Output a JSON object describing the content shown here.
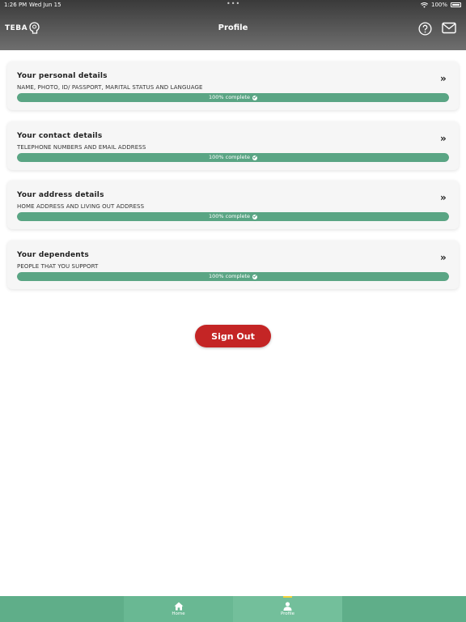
{
  "status_bar": {
    "time": "1:26 PM",
    "date": "Wed Jun 15",
    "battery": "100%"
  },
  "header": {
    "logo": "TEBA",
    "title": "Profile",
    "icons": [
      "help-icon",
      "mail-icon"
    ]
  },
  "cards": [
    {
      "title": "Your personal details",
      "subtitle": "NAME, PHOTO, ID/ PASSPORT, MARITAL STATUS AND LANGUAGE",
      "progress_label": "100% complete",
      "progress": 1.0
    },
    {
      "title": "Your contact details",
      "subtitle": "TELEPHONE NUMBERS AND EMAIL ADDRESS",
      "progress_label": "100% complete",
      "progress": 1.0
    },
    {
      "title": "Your address details",
      "subtitle": "HOME ADDRESS AND LIVING OUT ADDRESS",
      "progress_label": "100% complete",
      "progress": 1.0
    },
    {
      "title": "Your dependents",
      "subtitle": "PEOPLE THAT YOU SUPPORT",
      "progress_label": "100% complete",
      "progress": 1.0
    }
  ],
  "sign_out_label": "Sign Out",
  "tabs": [
    {
      "label": "Home",
      "icon": "home-icon"
    },
    {
      "label": "Profile",
      "icon": "person-icon",
      "active": true
    }
  ],
  "colors": {
    "header": "#4a4a4a",
    "progress": "#5aa584",
    "sign_out": "#c42525",
    "tabbar": "#5fae89",
    "active_indicator": "#f2d23a"
  }
}
